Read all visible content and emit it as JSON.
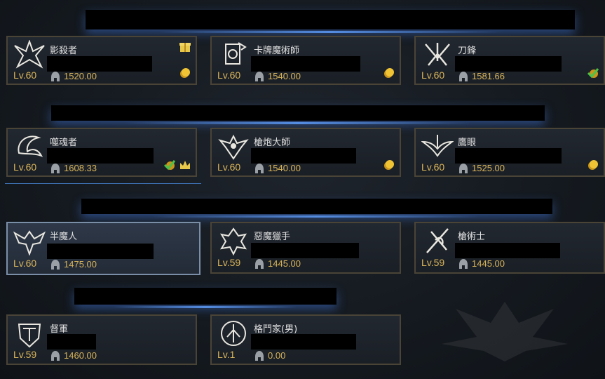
{
  "colors": {
    "level": "#d8b45a",
    "name": "#e1e1e1",
    "frame": "#4a4437",
    "selected_frame": "#7b8ea8",
    "banner_glow": "#3c6ec8"
  },
  "characters": [
    {
      "name": "影殺者",
      "level": "Lv.60",
      "item_level": "1520.00",
      "icon": "shadow-hunter-emblem-icon",
      "badges": [
        "gift-icon",
        "gold-coin-icon"
      ]
    },
    {
      "name": "卡牌魔術師",
      "level": "Lv.60",
      "item_level": "1540.00",
      "icon": "arcanist-emblem-icon",
      "badges": [
        "gold-coin-icon"
      ]
    },
    {
      "name": "刀鋒",
      "level": "Lv.60",
      "item_level": "1581.66",
      "icon": "deathblade-emblem-icon",
      "badges": [
        "check-coin-icon"
      ]
    },
    {
      "name": "噬魂者",
      "level": "Lv.60",
      "item_level": "1608.33",
      "icon": "souleater-emblem-icon",
      "badges": [
        "check-coin-icon",
        "crown-icon"
      ]
    },
    {
      "name": "槍炮大師",
      "level": "Lv.60",
      "item_level": "1540.00",
      "icon": "gunlancer-emblem-icon",
      "badges": [
        "gold-coin-icon"
      ]
    },
    {
      "name": "鷹眼",
      "level": "Lv.60",
      "item_level": "1525.00",
      "icon": "sharpshooter-emblem-icon",
      "badges": [
        "gold-coin-icon"
      ]
    },
    {
      "name": "半魔人",
      "level": "Lv.60",
      "item_level": "1475.00",
      "icon": "demonic-emblem-icon",
      "badges": []
    },
    {
      "name": "惡魔獵手",
      "level": "Lv.59",
      "item_level": "1445.00",
      "icon": "deadeye-emblem-icon",
      "badges": []
    },
    {
      "name": "槍術士",
      "level": "Lv.59",
      "item_level": "1445.00",
      "icon": "lancemaster-emblem-icon",
      "badges": []
    },
    {
      "name": "督軍",
      "level": "Lv.59",
      "item_level": "1460.00",
      "icon": "warlord-emblem-icon",
      "badges": []
    },
    {
      "name": "格鬥家(男)",
      "level": "Lv.1",
      "item_level": "0.00",
      "icon": "striker-emblem-icon",
      "badges": []
    }
  ]
}
